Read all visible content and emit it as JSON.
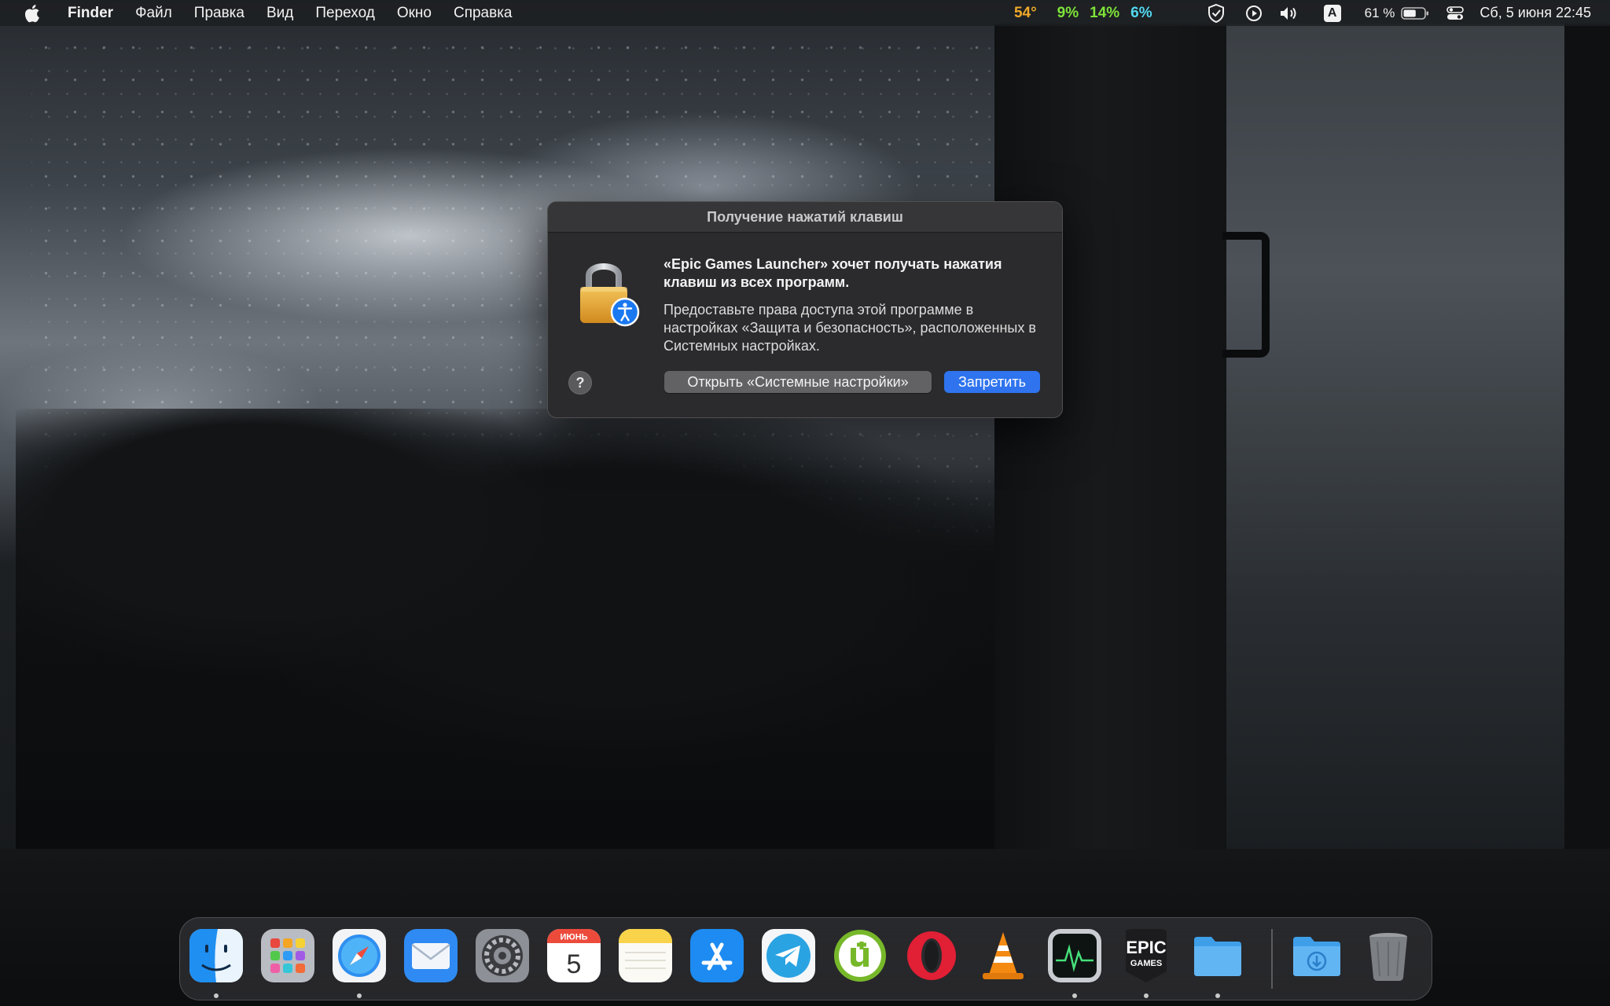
{
  "menubar": {
    "app_name": "Finder",
    "menus": [
      "Файл",
      "Правка",
      "Вид",
      "Переход",
      "Окно",
      "Справка"
    ],
    "stats": [
      {
        "label": "54°",
        "color": "#f0a92a"
      },
      {
        "label": "9%",
        "color": "#7ee33a"
      },
      {
        "label": "14%",
        "color": "#7ee33a"
      },
      {
        "label": "6%",
        "color": "#52d8f0"
      }
    ],
    "icons": [
      "adguard-shield-icon",
      "play-circle-icon",
      "volume-icon",
      "input-source-icon"
    ],
    "input_source_label": "A",
    "battery_percent": "61 %",
    "battery_level": 0.61,
    "datetime": "Сб, 5 июня  22:45"
  },
  "dialog": {
    "title": "Получение нажатий клавиш",
    "headline": "«Epic Games Launcher» хочет получать нажатия клавиш из всех программ.",
    "body": "Предоставьте права доступа этой программе в настройках «Защита и безопасность», расположенных в Системных настройках.",
    "help_label": "?",
    "open_settings_label": "Открыть «Системные настройки»",
    "deny_label": "Запретить",
    "accent_color": "#2f74ee"
  },
  "dock": {
    "calendar_month": "ИЮНЬ",
    "calendar_day": "5",
    "epic_line1": "EPIC",
    "epic_line2": "GAMES",
    "items": [
      {
        "name": "finder",
        "running": true
      },
      {
        "name": "launchpad",
        "running": false
      },
      {
        "name": "safari",
        "running": true
      },
      {
        "name": "mail",
        "running": false
      },
      {
        "name": "system-preferences",
        "running": false
      },
      {
        "name": "calendar",
        "running": false
      },
      {
        "name": "notes",
        "running": false
      },
      {
        "name": "app-store",
        "running": false
      },
      {
        "name": "telegram",
        "running": false
      },
      {
        "name": "utorrent",
        "running": false
      },
      {
        "name": "opera",
        "running": false
      },
      {
        "name": "vlc",
        "running": false
      },
      {
        "name": "activity-monitor",
        "running": true
      },
      {
        "name": "epic-games",
        "running": true
      },
      {
        "name": "folder",
        "running": true
      },
      {
        "name": "downloads",
        "running": false
      },
      {
        "name": "trash",
        "running": false
      }
    ]
  }
}
